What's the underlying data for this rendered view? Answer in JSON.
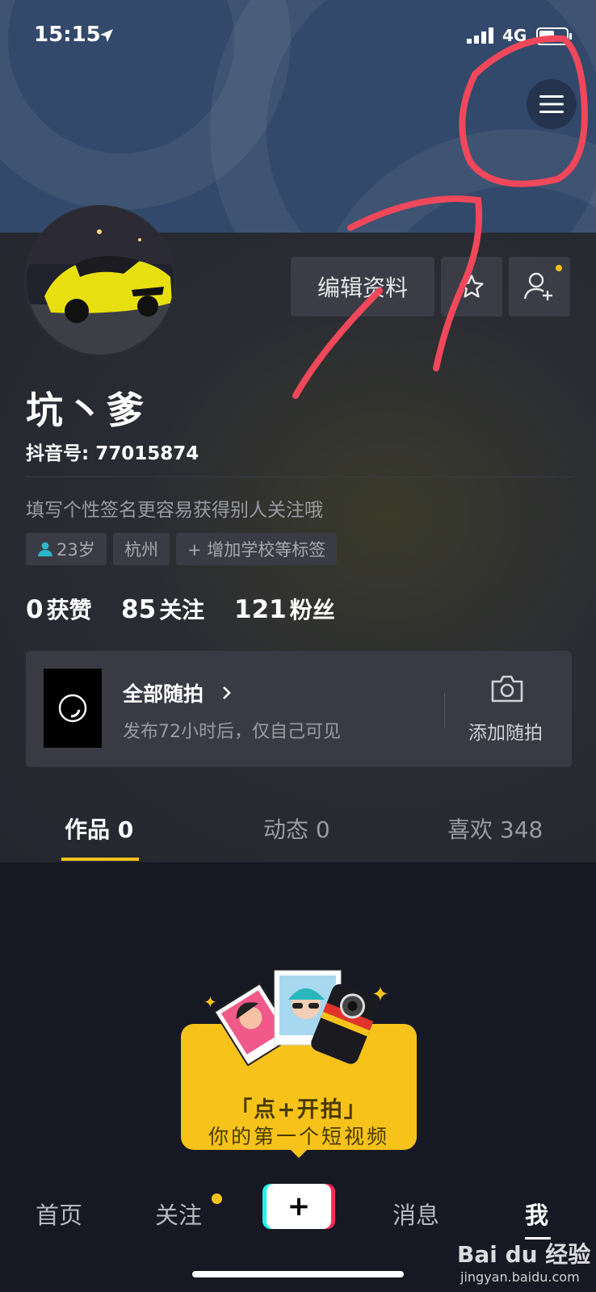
{
  "status_bar": {
    "time": "15:15",
    "network": "4G"
  },
  "profile": {
    "nickname": "坑丶爹",
    "douyin_id": "抖音号: 77015874",
    "bio_placeholder": "填写个性签名更容易获得别人关注哦",
    "tags": [
      "23岁",
      "杭州",
      "+ 增加学校等标签"
    ]
  },
  "actions": {
    "edit_profile": "编辑资料"
  },
  "stats": [
    {
      "value": "0",
      "label": "获赞"
    },
    {
      "value": "85",
      "label": "关注"
    },
    {
      "value": "121",
      "label": "粉丝"
    }
  ],
  "story": {
    "title": "全部随拍",
    "subtitle": "发布72小时后，仅自己可见",
    "add_label": "添加随拍"
  },
  "tabs": [
    {
      "label": "作品 0",
      "active": true
    },
    {
      "label": "动态 0",
      "active": false
    },
    {
      "label": "喜欢 348",
      "active": false
    }
  ],
  "promo": {
    "line1": "「点+开拍」",
    "line2": "你的第一个短视频"
  },
  "bottom_nav": {
    "home": "首页",
    "following": "关注",
    "plus": "+",
    "messages": "消息",
    "me": "我"
  },
  "watermark": {
    "logo": "Bai du 经验",
    "url": "jingyan.baidu.com"
  },
  "colors": {
    "accent": "#f7c31b",
    "background": "#161823",
    "annotation": "#f0485a"
  }
}
